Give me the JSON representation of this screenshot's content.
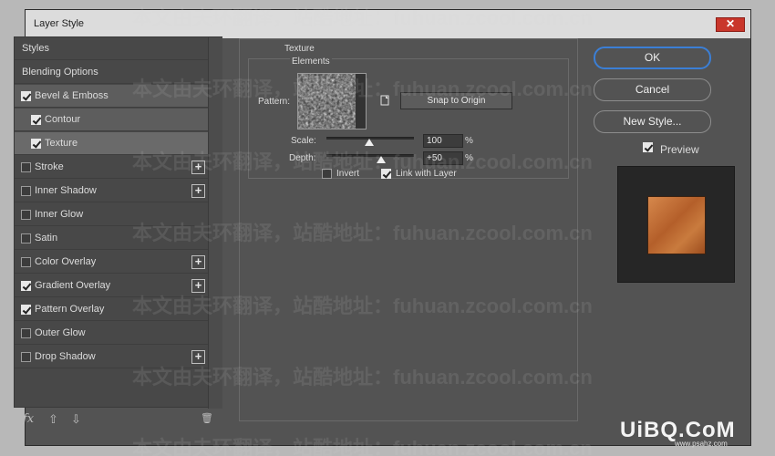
{
  "window": {
    "title": "Layer Style",
    "close_glyph": "✕"
  },
  "styles_panel": {
    "header": "Styles",
    "blending": "Blending Options",
    "items": [
      {
        "label": "Bevel & Emboss",
        "checked": true,
        "plus": false
      },
      {
        "label": "Contour",
        "checked": true,
        "plus": false
      },
      {
        "label": "Texture",
        "checked": true,
        "plus": false
      },
      {
        "label": "Stroke",
        "checked": false,
        "plus": true
      },
      {
        "label": "Inner Shadow",
        "checked": false,
        "plus": true
      },
      {
        "label": "Inner Glow",
        "checked": false,
        "plus": false
      },
      {
        "label": "Satin",
        "checked": false,
        "plus": false
      },
      {
        "label": "Color Overlay",
        "checked": false,
        "plus": true
      },
      {
        "label": "Gradient Overlay",
        "checked": true,
        "plus": true
      },
      {
        "label": "Pattern Overlay",
        "checked": true,
        "plus": false
      },
      {
        "label": "Outer Glow",
        "checked": false,
        "plus": false
      },
      {
        "label": "Drop Shadow",
        "checked": false,
        "plus": true
      }
    ],
    "plus_glyph": "+",
    "footer": {
      "fx": "fx",
      "up_glyph": "⇧",
      "down_glyph": "⇩",
      "trash_glyph": "🗑"
    }
  },
  "texture": {
    "group_title": "Texture",
    "elements_title": "Elements",
    "pattern_label": "Pattern:",
    "dropdown_glyph": "⌄",
    "snap_button": "Snap to Origin",
    "scale_label": "Scale:",
    "scale_value": "100",
    "scale_level": 0.49,
    "depth_label": "Depth:",
    "depth_value": "+50",
    "depth_level": 0.62,
    "unit": "%",
    "invert_label": "Invert",
    "invert_checked": false,
    "link_label": "Link with Layer",
    "link_checked": true
  },
  "buttons": {
    "ok": "OK",
    "cancel": "Cancel",
    "new_style": "New Style..."
  },
  "preview": {
    "label": "Preview",
    "checked": true
  },
  "watermark": {
    "text": "本文由夫环翻译，站酷地址：fuhuan.zcool.com.cn",
    "logo": "UiBQ.CoM",
    "logo_sub": "www.psahz.com"
  },
  "colors": {
    "accent": "#3b7fd6",
    "close": "#c9362b",
    "copper": "#c97b3e"
  }
}
